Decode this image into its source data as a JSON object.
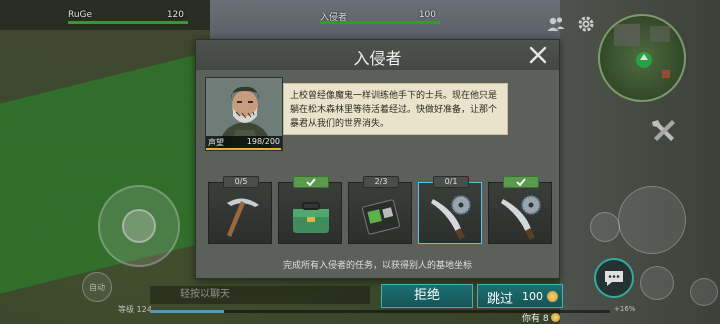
{
  "hud": {
    "player_name": "RuGe",
    "player_hp": "120",
    "raider_name": "入侵者",
    "raider_hp": "100"
  },
  "chat": {
    "placeholder": "轻按以聊天"
  },
  "level": {
    "label": "等级 124",
    "xp_percent": "+16%",
    "xp_fraction": 0.16
  },
  "joystick": {
    "auto_label": "自动"
  },
  "dialog": {
    "title": "入侵者",
    "story": "上校曾经像魔鬼一样训练他手下的士兵。现在他只是躺在松木森林里等待活着经过。快做好准备，让那个暴君从我们的世界消失。",
    "reputation_label": "声望",
    "reputation_value": "198/200",
    "reputation_fraction": 0.99,
    "objective": "完成所有入侵者的任务，以获得别人的基地坐标",
    "tasks": [
      {
        "progress": "0/5",
        "done": false,
        "icon": "pickaxe-icon"
      },
      {
        "progress": "",
        "done": true,
        "icon": "toolbox-icon"
      },
      {
        "progress": "2/3",
        "done": false,
        "icon": "blueprint-icon"
      },
      {
        "progress": "0/1",
        "done": false,
        "icon": "sawblade-machete-icon"
      },
      {
        "progress": "",
        "done": true,
        "icon": "sawblade-machete-icon"
      }
    ]
  },
  "buttons": {
    "refuse": "拒绝",
    "skip": "跳过",
    "skip_cost": "100",
    "have_label": "你有 8"
  },
  "colors": {
    "accent_teal": "#3fb2b3",
    "hp_green": "#3fae3a",
    "reputation_gold": "#e2b52c"
  }
}
